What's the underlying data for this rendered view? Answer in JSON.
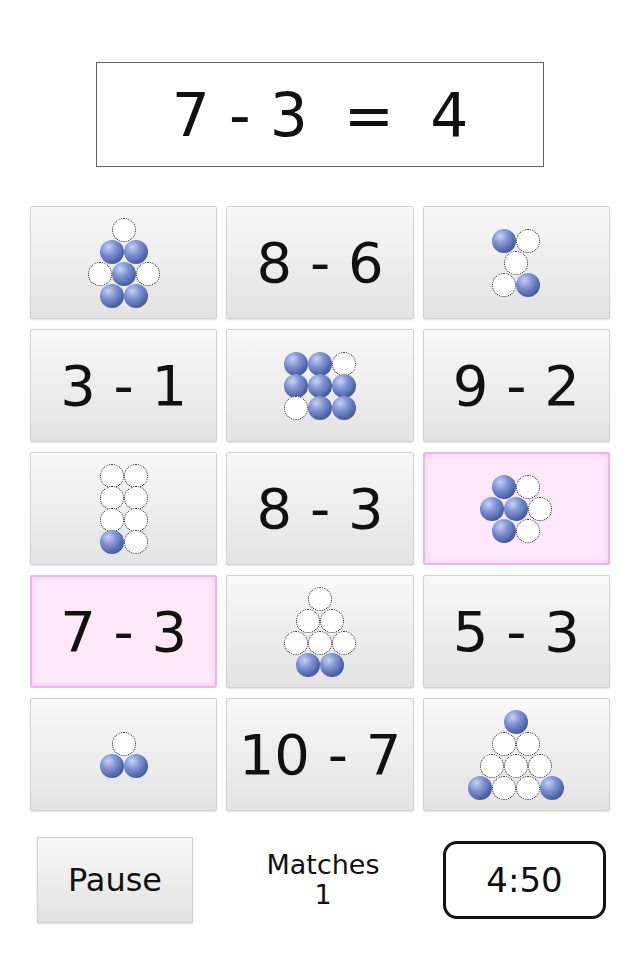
{
  "equation": {
    "expression": "7 - 3",
    "sign": "=",
    "result": "4"
  },
  "tiles": [
    {
      "kind": "dots",
      "selected": false,
      "rows": [
        [
          false
        ],
        [
          true,
          true
        ],
        [
          false,
          true,
          false
        ],
        [
          true,
          true
        ]
      ]
    },
    {
      "kind": "expression",
      "selected": false,
      "text": "8 - 6"
    },
    {
      "kind": "dots",
      "selected": false,
      "rows": [
        [
          true,
          false
        ],
        [
          false
        ],
        [
          false,
          true
        ]
      ]
    },
    {
      "kind": "expression",
      "selected": false,
      "text": "3 - 1"
    },
    {
      "kind": "dots",
      "selected": false,
      "rows": [
        [
          true,
          true,
          false
        ],
        [
          true,
          true,
          true
        ],
        [
          false,
          true,
          true
        ]
      ]
    },
    {
      "kind": "expression",
      "selected": false,
      "text": "9 - 2"
    },
    {
      "kind": "dots",
      "selected": false,
      "rows": [
        [
          false,
          false
        ],
        [
          false,
          false
        ],
        [
          false,
          false
        ],
        [
          true,
          false
        ]
      ]
    },
    {
      "kind": "expression",
      "selected": false,
      "text": "8 - 3"
    },
    {
      "kind": "dots",
      "selected": true,
      "rows": [
        [
          true,
          false
        ],
        [
          true,
          true,
          false
        ],
        [
          true,
          false
        ]
      ]
    },
    {
      "kind": "expression",
      "selected": true,
      "text": "7 - 3"
    },
    {
      "kind": "dots",
      "selected": false,
      "rows": [
        [
          false
        ],
        [
          false,
          false
        ],
        [
          false,
          false,
          false
        ],
        [
          true,
          true
        ]
      ]
    },
    {
      "kind": "expression",
      "selected": false,
      "text": "5 - 3"
    },
    {
      "kind": "dots",
      "selected": false,
      "rows": [
        [
          false
        ],
        [
          true,
          true
        ]
      ]
    },
    {
      "kind": "expression",
      "selected": false,
      "text": "10 - 7"
    },
    {
      "kind": "dots",
      "selected": false,
      "rows": [
        [
          true
        ],
        [
          false,
          false
        ],
        [
          false,
          false,
          false
        ],
        [
          true,
          false,
          false,
          true
        ]
      ]
    }
  ],
  "controls": {
    "pause": "Pause",
    "matches_label": "Matches",
    "matches": "1",
    "timer": "4:50"
  }
}
